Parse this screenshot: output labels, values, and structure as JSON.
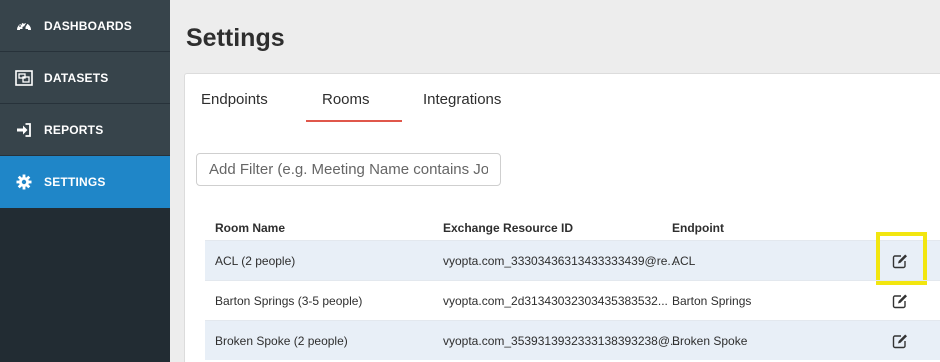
{
  "sidebar": {
    "items": [
      {
        "label": "DASHBOARDS",
        "icon": "gauge-icon",
        "active": false
      },
      {
        "label": "DATASETS",
        "icon": "datasets-icon",
        "active": false
      },
      {
        "label": "REPORTS",
        "icon": "sign-in-icon",
        "active": false
      },
      {
        "label": "SETTINGS",
        "icon": "gear-icon",
        "active": true
      }
    ]
  },
  "page": {
    "title": "Settings"
  },
  "tabs": [
    {
      "label": "Endpoints",
      "active": false
    },
    {
      "label": "Rooms",
      "active": true
    },
    {
      "label": "Integrations",
      "active": false
    }
  ],
  "filter": {
    "placeholder": "Add Filter (e.g. Meeting Name contains John)",
    "value": ""
  },
  "table": {
    "headers": [
      "Room Name",
      "Exchange Resource ID",
      "Endpoint"
    ],
    "rows": [
      {
        "room": "ACL (2 people)",
        "resource_id": "vyopta.com_33303436313433333439@re...",
        "endpoint": "ACL",
        "action_icon": "edit-icon",
        "highlighted": true
      },
      {
        "room": "Barton Springs (3-5 people)",
        "resource_id": "vyopta.com_2d31343032303435383532...",
        "endpoint": "Barton Springs",
        "action_icon": "edit-icon",
        "highlighted": false
      },
      {
        "room": "Broken Spoke (2 people)",
        "resource_id": "vyopta.com_3539313932333138393238@...",
        "endpoint": "Broken Spoke",
        "action_icon": "edit-icon",
        "highlighted": false
      }
    ]
  },
  "colors": {
    "sidebar_bg": "#37444b",
    "sidebar_active": "#1f86c8",
    "tab_accent": "#e0574b",
    "row_alt": "#e8eff7",
    "highlight": "#f2e60f"
  }
}
